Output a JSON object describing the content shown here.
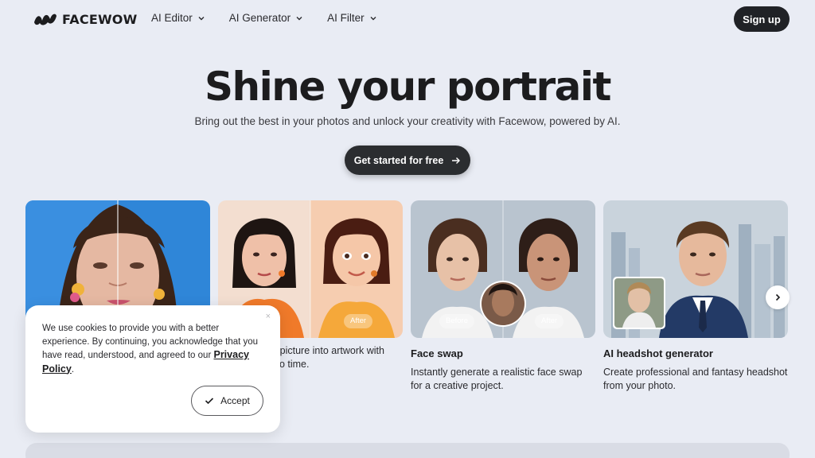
{
  "brand": {
    "name": "FACEWOW"
  },
  "nav": {
    "items": [
      {
        "label": "AI Editor"
      },
      {
        "label": "AI Generator"
      },
      {
        "label": "AI Filter"
      }
    ],
    "signup_label": "Sign up"
  },
  "hero": {
    "title": "Shine your portrait",
    "subtitle": "Bring out the best in your photos and unlock your creativity with Facewow, powered by AI.",
    "cta_label": "Get started for free"
  },
  "cards": [
    {
      "title": "",
      "description": ""
    },
    {
      "title": "",
      "description": "r picture into artwork with\nno time.",
      "after_label": "After"
    },
    {
      "title": "Face swap",
      "description": "Instantly generate a realistic face swap for a creative project.",
      "before_label": "Before",
      "after_label": "After"
    },
    {
      "title": "AI headshot generator",
      "description": "Create professional and fantasy headshot from your photo."
    }
  ],
  "cookie": {
    "message": "We use cookies to provide you with a better experience. By continuing, you acknowledge that you have read, understood, and agreed to our",
    "link_label": "Privacy Policy",
    "period": ".",
    "close": "×",
    "accept_label": "Accept"
  },
  "colors": {
    "background": "#e9ecf4",
    "dark_button": "#202226",
    "text": "#1c1c1e"
  }
}
